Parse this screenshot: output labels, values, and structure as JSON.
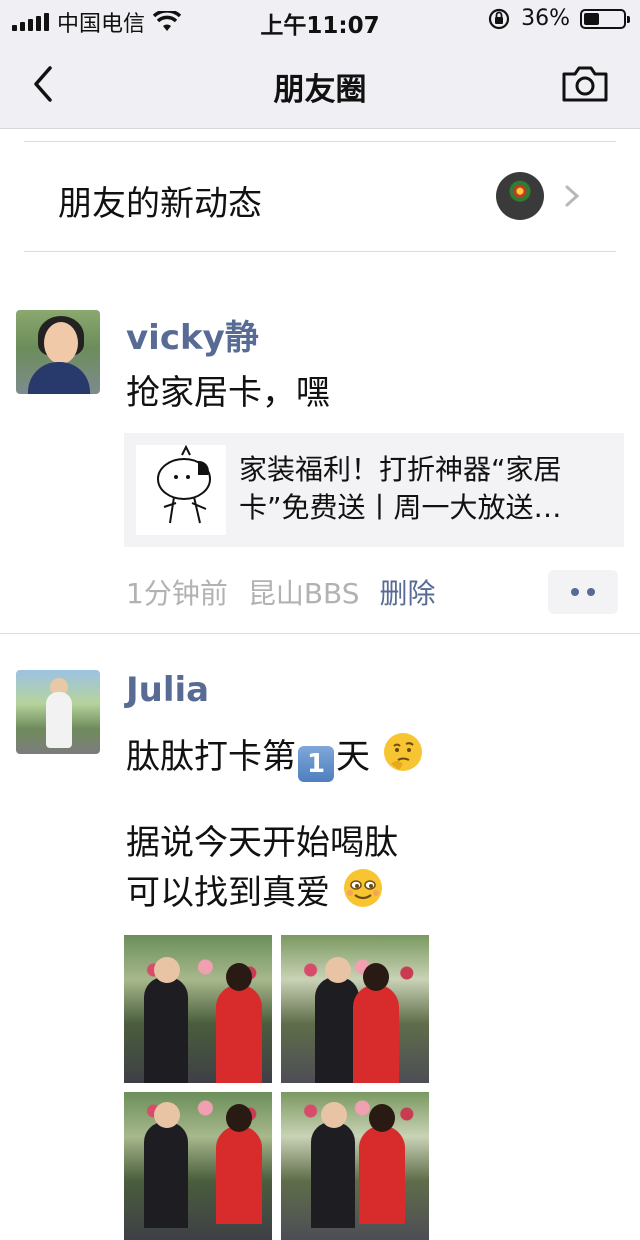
{
  "status_bar": {
    "carrier": "中国电信",
    "time": "上午11:07",
    "battery": "36%",
    "battery_level": 0.36
  },
  "nav": {
    "title": "朋友圈",
    "back_icon": "chevron-left-icon",
    "camera_icon": "camera-icon"
  },
  "friend_updates": {
    "label": "朋友的新动态"
  },
  "posts": [
    {
      "name": "vicky静",
      "text": "抢家居卡，嘿",
      "link": {
        "title": "家装福利！打折神器“家居卡”免费送丨周一大放送…"
      },
      "meta": {
        "time": "1分钟前",
        "source": "昆山BBS",
        "delete": "删除"
      }
    },
    {
      "name": "Julia",
      "line1_before": "肽肽打卡第",
      "line1_keycap": "1",
      "line1_after": "天",
      "line2": "据说今天开始喝肽",
      "line3": "可以找到真爱"
    }
  ],
  "colors": {
    "link_blue": "#576b95",
    "bar_bg": "#efeff4",
    "meta_gray": "#b2b2b2"
  }
}
